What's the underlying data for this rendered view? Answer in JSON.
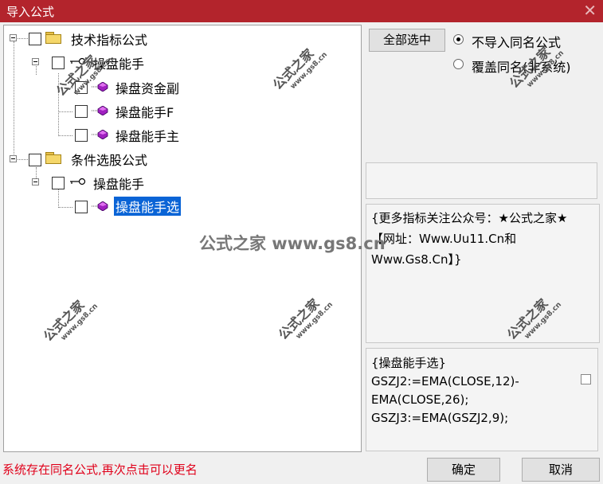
{
  "window": {
    "title": "导入公式",
    "close_glyph": "✕"
  },
  "tree": {
    "items": [
      {
        "label": "技术指标公式"
      },
      {
        "label": "操盘能手"
      },
      {
        "label": "操盘资金副"
      },
      {
        "label": "操盘能手F"
      },
      {
        "label": "操盘能手主"
      },
      {
        "label": "条件选股公式"
      },
      {
        "label": "操盘能手"
      },
      {
        "label": "操盘能手选"
      }
    ]
  },
  "buttons": {
    "select_all": "全部选中",
    "ok": "确定",
    "cancel": "取消"
  },
  "options": {
    "no_import": "不导入同名公式",
    "overwrite": "覆盖同名(非系统)",
    "selected": "no_import"
  },
  "info_text": "{更多指标关注公众号：★公式之家★【网址：Www.Uu11.Cn和Www.Gs8.Cn】}",
  "code_text": "{操盘能手选}\nGSZJ2:=EMA(CLOSE,12)-EMA(CLOSE,26);\nGSZJ3:=EMA(GSZJ2,9);",
  "status_text": "系统存在同名公式,再次点击可以更名",
  "watermark": {
    "text": "公式之家",
    "url": "www.gs8.cn",
    "banner": "公式之家 www.gs8.cn"
  },
  "icons": [
    "folder-icon",
    "key-icon",
    "formula-gem-icon",
    "close-icon"
  ],
  "colors": {
    "titlebar": "#b3242c",
    "selection": "#0a64d6",
    "status": "#e0001a"
  }
}
